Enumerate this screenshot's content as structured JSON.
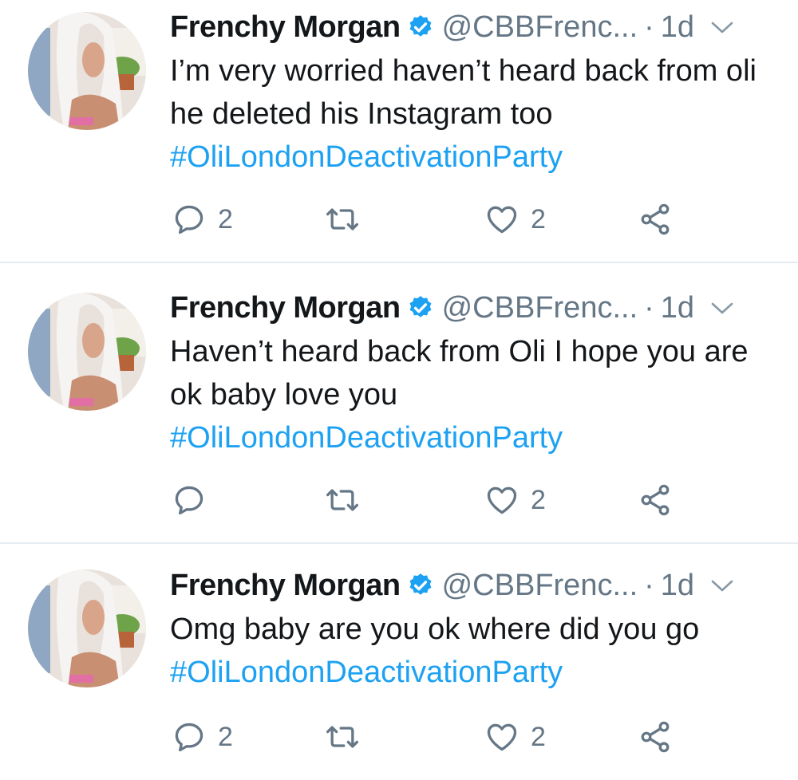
{
  "tweets": [
    {
      "name": "Frenchy Morgan",
      "handle": "@CBBFrenc...",
      "dot": "·",
      "time": "1d",
      "text": "I’m very worried haven’t heard back from oli he deleted  his Instagram too",
      "hashtag": "#OliLondonDeactivationParty",
      "reply_count": "2",
      "retweet_count": "",
      "like_count": "2"
    },
    {
      "name": "Frenchy Morgan",
      "handle": "@CBBFrenc...",
      "dot": "·",
      "time": "1d",
      "text": "Haven’t heard back from Oli I hope you are ok baby love you",
      "hashtag": "#OliLondonDeactivationParty",
      "reply_count": "",
      "retweet_count": "",
      "like_count": "2"
    },
    {
      "name": "Frenchy Morgan",
      "handle": "@CBBFrenc...",
      "dot": "·",
      "time": "1d",
      "text": "Omg baby are you ok where did you go",
      "hashtag": "#OliLondonDeactivationParty",
      "reply_count": "2",
      "retweet_count": "",
      "like_count": "2"
    }
  ],
  "icons": {
    "verified": "verified-badge-icon",
    "chevron": "chevron-down-icon",
    "reply": "reply-icon",
    "retweet": "retweet-icon",
    "like": "heart-icon",
    "share": "share-icon"
  },
  "colors": {
    "text": "#14171a",
    "secondary": "#657786",
    "link": "#1da1f2",
    "verified": "#1da1f2",
    "divider": "#e6ecf0"
  }
}
